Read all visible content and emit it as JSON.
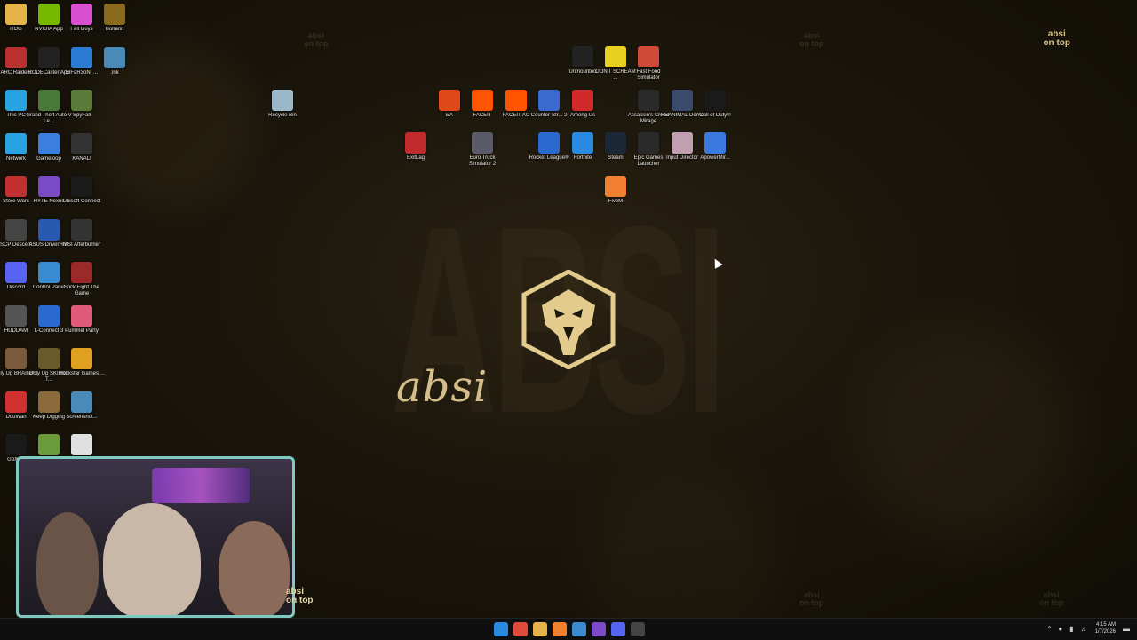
{
  "watermark": {
    "line1": "absi",
    "line2": "on top"
  },
  "wallpaper": {
    "big_text": "ABSI",
    "script_text": "absi"
  },
  "desktop_icons_left": [
    {
      "label": "ROG",
      "icon": "folder-icon",
      "color": "#e6b34a"
    },
    {
      "label": "NVIDIA App",
      "icon": "nvidia-icon",
      "color": "#76b900"
    },
    {
      "label": "Fall Guys",
      "icon": "fall-guys-icon",
      "color": "#d94fcf"
    },
    {
      "label": "Bonanit",
      "icon": "bonanit-icon",
      "color": "#8a6a1c"
    },
    {
      "label": "ARC Raiders",
      "icon": "arc-raiders-icon",
      "color": "#b83030"
    },
    {
      "label": "RODECaster App",
      "icon": "rodecaster-icon",
      "color": "#222222"
    },
    {
      "label": "ElFaR3oN_...",
      "icon": "document-icon",
      "color": "#2b7bd6"
    },
    {
      "label": ".lnk",
      "icon": "shortcut-icon",
      "color": "#4a8ab8"
    },
    {
      "label": "This PC",
      "icon": "this-pc-icon",
      "color": "#2aa4e0"
    },
    {
      "label": "Grand Theft Auto V Le...",
      "icon": "gta-icon",
      "color": "#4a7a3a"
    },
    {
      "label": "SpyFall",
      "icon": "spyfall-icon",
      "color": "#5a7a3a"
    },
    {
      "label": "Network",
      "icon": "network-icon",
      "color": "#2aa4e0"
    },
    {
      "label": "Gameloop",
      "icon": "gameloop-icon",
      "color": "#3a7ee0"
    },
    {
      "label": "KANALI",
      "icon": "kanali-icon",
      "color": "#333333"
    },
    {
      "label": "Store Wars",
      "icon": "store-wars-icon",
      "color": "#c23030"
    },
    {
      "label": "HYTE Nexus",
      "icon": "hyte-icon",
      "color": "#7a4ac9"
    },
    {
      "label": "Ubisoft Connect",
      "icon": "ubisoft-icon",
      "color": "#1a1a1a"
    },
    {
      "label": "SCP Descent",
      "icon": "scp-icon",
      "color": "#444444"
    },
    {
      "label": "ASUS DriverHub",
      "icon": "asus-icon",
      "color": "#2a5ab0"
    },
    {
      "label": "MSI Afterburner",
      "icon": "msi-icon",
      "color": "#333333"
    },
    {
      "label": "Discord",
      "icon": "discord-icon",
      "color": "#5865f2"
    },
    {
      "label": "Control Panel",
      "icon": "control-panel-icon",
      "color": "#3a8ad0"
    },
    {
      "label": "Stick Fight The Game",
      "icon": "stick-fight-icon",
      "color": "#9a2a2a"
    },
    {
      "label": "HUDDAM",
      "icon": "huddam-icon",
      "color": "#555555"
    },
    {
      "label": "L-Connect 3",
      "icon": "lconnect-icon",
      "color": "#2a6ad0"
    },
    {
      "label": "Pummel Party",
      "icon": "pummel-party-icon",
      "color": "#e05a7a"
    },
    {
      "label": "Only Up BRAINR...",
      "icon": "only-up-icon",
      "color": "#7a5a3a"
    },
    {
      "label": "Only Up SKIBIDI T...",
      "icon": "only-up-skibidi-icon",
      "color": "#6a5a2a"
    },
    {
      "label": "Rockstar Games ...",
      "icon": "rockstar-icon",
      "color": "#e0a020"
    },
    {
      "label": "DouWan",
      "icon": "douwan-icon",
      "color": "#d03030"
    },
    {
      "label": "Keep Digging",
      "icon": "keep-digging-icon",
      "color": "#8a6a3a"
    },
    {
      "label": "Screenshot...",
      "icon": "screenshot-icon",
      "color": "#4a8ab8"
    },
    {
      "label": "GoXLR",
      "icon": "goxlr-icon",
      "color": "#1a1a1a"
    },
    {
      "label": "",
      "icon": "minecraft-icon",
      "color": "#6a9a3a"
    },
    {
      "label": "",
      "icon": "chrome-icon",
      "color": "#e0e0e0"
    }
  ],
  "desktop_icons_center": [
    {
      "label": "Recycle Bin",
      "icon": "recycle-bin-icon",
      "color": "#9ab8c8"
    },
    {
      "label": "Unmounted",
      "icon": "unmounted-icon",
      "color": "#222222"
    },
    {
      "label": "DON'T SCREAM ...",
      "icon": "dont-scream-icon",
      "color": "#e8d020"
    },
    {
      "label": "Fast Food Simulator",
      "icon": "fast-food-icon",
      "color": "#d04a3a"
    },
    {
      "label": "EA",
      "icon": "ea-icon",
      "color": "#e04a1a"
    },
    {
      "label": "FACEIT",
      "icon": "faceit-icon",
      "color": "#ff5500"
    },
    {
      "label": "FACEIT AC",
      "icon": "faceit-ac-icon",
      "color": "#ff5500"
    },
    {
      "label": "Counter-Str... 2",
      "icon": "counter-strike-icon",
      "color": "#3a6ad0"
    },
    {
      "label": "Among Us",
      "icon": "among-us-icon",
      "color": "#d02a2a"
    },
    {
      "label": "Assassin's Creed Mirage",
      "icon": "assassins-creed-icon",
      "color": "#2a2a2a"
    },
    {
      "label": "REANIMAL Demo",
      "icon": "reanimal-icon",
      "color": "#3a4a6a"
    },
    {
      "label": "Call of Duty®",
      "icon": "call-of-duty-icon",
      "color": "#1a1a1a"
    },
    {
      "label": "ExitLag",
      "icon": "exitlag-icon",
      "color": "#c02a2a"
    },
    {
      "label": "Euro Truck Simulator 2",
      "icon": "euro-truck-icon",
      "color": "#5a5a6a"
    },
    {
      "label": "Rocket League®",
      "icon": "rocket-league-icon",
      "color": "#2a6ad0"
    },
    {
      "label": "Fortnite",
      "icon": "fortnite-icon",
      "color": "#2a8ae0"
    },
    {
      "label": "Steam",
      "icon": "steam-icon",
      "color": "#1b2838"
    },
    {
      "label": "Epic Games Launcher",
      "icon": "epic-games-icon",
      "color": "#2a2a2a"
    },
    {
      "label": "Input Director",
      "icon": "input-director-icon",
      "color": "#c0a0b0"
    },
    {
      "label": "ApowerMir...",
      "icon": "apowermirror-icon",
      "color": "#3a7ae0"
    },
    {
      "label": "FiveM",
      "icon": "fivem-icon",
      "color": "#f08030"
    }
  ],
  "webcam": {
    "badge_line1": "absi",
    "badge_line2": "on top"
  },
  "taskbar": {
    "apps": [
      {
        "icon": "start-icon",
        "color": "#2a8ae0"
      },
      {
        "icon": "chrome-icon",
        "color": "#e04a3a"
      },
      {
        "icon": "file-explorer-icon",
        "color": "#e6b34a"
      },
      {
        "icon": "fivem-icon",
        "color": "#f08030"
      },
      {
        "icon": "app-icon",
        "color": "#3a8ad0"
      },
      {
        "icon": "hyte-icon",
        "color": "#7a4ac9"
      },
      {
        "icon": "discord-icon",
        "color": "#5865f2"
      },
      {
        "icon": "capture-icon",
        "color": "#444444"
      }
    ],
    "time": "4:15 AM",
    "date": "1/7/2026"
  }
}
